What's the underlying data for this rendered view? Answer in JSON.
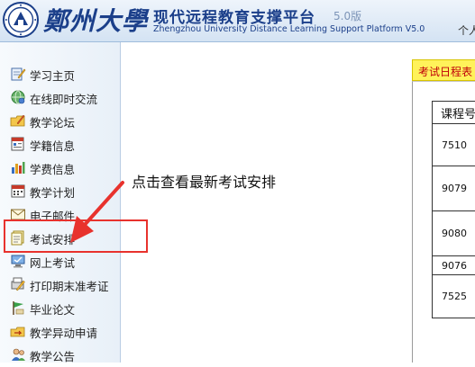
{
  "header": {
    "university_name": "鄭州大學",
    "platform_title": "现代远程教育支撑平台",
    "version": "5.0版",
    "platform_title_en": "Zhengzhou University Distance Learning Support Platform V5.0",
    "right_text": "个人"
  },
  "sidebar": {
    "items": [
      {
        "label": "学习主页",
        "icon": "notebook-pencil-icon"
      },
      {
        "label": "在线即时交流",
        "icon": "chat-globe-icon"
      },
      {
        "label": "教学论坛",
        "icon": "forum-folder-icon"
      },
      {
        "label": "学籍信息",
        "icon": "student-record-icon"
      },
      {
        "label": "学费信息",
        "icon": "fee-chart-icon"
      },
      {
        "label": "教学计划",
        "icon": "calendar-icon"
      },
      {
        "label": "电子邮件",
        "icon": "email-icon"
      },
      {
        "label": "考试安排",
        "icon": "exam-schedule-icon"
      },
      {
        "label": "网上考试",
        "icon": "online-exam-icon"
      },
      {
        "label": "打印期末准考证",
        "icon": "print-pencil-icon"
      },
      {
        "label": "毕业论文",
        "icon": "thesis-flag-icon"
      },
      {
        "label": "教学异动申请",
        "icon": "change-request-icon"
      },
      {
        "label": "教学公告",
        "icon": "announcement-icon"
      }
    ]
  },
  "annotation": {
    "hint": "点击查看最新考试安排"
  },
  "exam_panel": {
    "tab_label": "考试日程表",
    "table": {
      "header": "课程号",
      "rows": [
        "7510",
        "9079",
        "9080",
        "9076",
        "7525"
      ]
    }
  },
  "colors": {
    "brand_blue": "#1b3f8a",
    "annotation_red": "#e8322d",
    "tab_yellow": "#fff25a"
  }
}
